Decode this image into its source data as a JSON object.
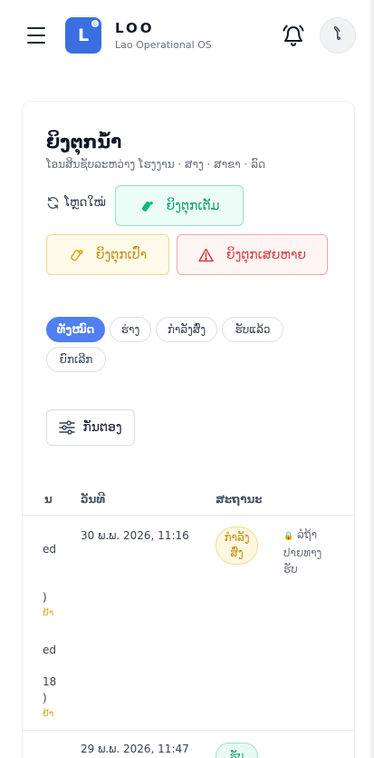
{
  "app": {
    "logo_letter": "L",
    "name": "LOO",
    "subtitle": "Lao Operational OS",
    "avatar_initial": "ໂ",
    "icons": {
      "menu": "hamburger-icon",
      "bell": "bell-icon"
    }
  },
  "page": {
    "title": "ຍິງຕຸກນໍ້າ",
    "subtitle": "ໂອນສິນຊັບລະຫວ່າງ ໂຮງງານ · ສາງ · ສາຂາ · ລົດ",
    "refresh_label": "ໂຫຼດໃໝ່",
    "buttons": {
      "full": "ຍິງຕຸກເຕັມ",
      "empty": "ຍິງຕຸກເປົ່າ",
      "broken": "ຍິງຕຸກເສຍຫາຍ"
    }
  },
  "filters": {
    "chips": [
      "ທັງໝົດ",
      "ຮ່າງ",
      "ກຳລັງສົ່ງ",
      "ຮັບແລ້ວ",
      "ຍົກເລີກ"
    ],
    "active": "ທັງໝົດ",
    "filter_label": "ກັ່ນຕອງ"
  },
  "table": {
    "columns": [
      "ນ",
      "ວັນທີ",
      "ສະຖານະ"
    ],
    "rows": [
      {
        "frags": [
          "ed",
          ")",
          "ຢ້າ",
          "ed",
          "18",
          ")",
          "ຢ້າ"
        ],
        "date": "30 ພ.ພ. 2026, 11:16",
        "status": "ກຳລັງ ສົ່ງ",
        "note": "ລໍຖ້າ ປາຍທາງ ຮັບ"
      },
      {
        "date": "29 ພ.ພ. 2026, 11:47",
        "status": "ຮັບ"
      }
    ]
  },
  "colors": {
    "primary": "#4f7ff0",
    "logo": "#3b6fe0",
    "green": "#0f9f6e",
    "amber": "#c98a09",
    "red": "#d63b3b"
  }
}
